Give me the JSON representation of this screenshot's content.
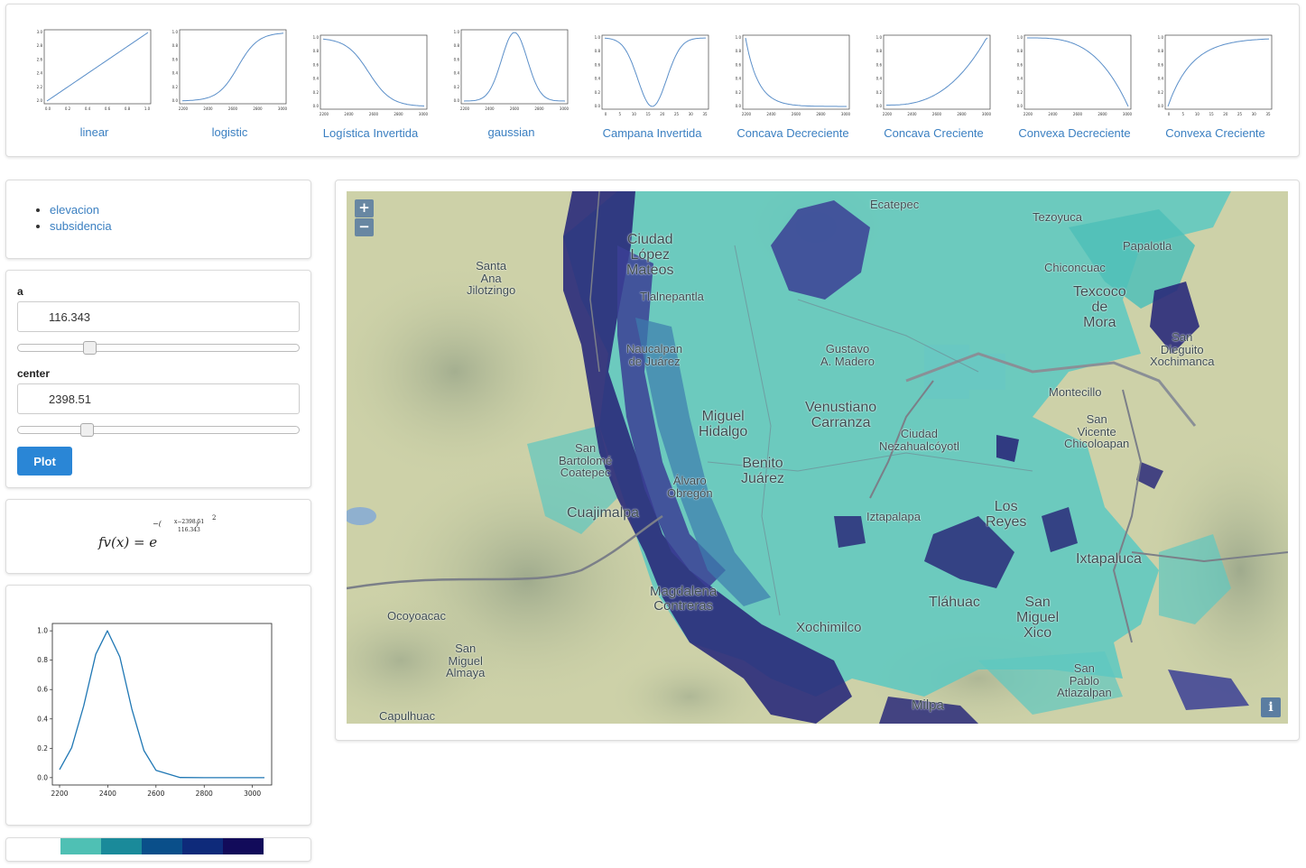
{
  "gallery": {
    "items": [
      {
        "label": "linear",
        "xticks": [
          "0.0",
          "0.2",
          "0.4",
          "0.6",
          "0.8",
          "1.0"
        ],
        "yticks": [
          "3.0",
          "2.8",
          "2.6",
          "2.4",
          "2.2",
          "2.0"
        ]
      },
      {
        "label": "logistic",
        "xticks": [
          "2200",
          "2400",
          "2600",
          "2800",
          "3000"
        ],
        "yticks": [
          "1.0",
          "0.8",
          "0.6",
          "0.4",
          "0.2",
          "0.0"
        ]
      },
      {
        "label": "Logística Invertida",
        "xticks": [
          "2200",
          "2400",
          "2600",
          "2800",
          "3000"
        ],
        "yticks": [
          "1.0",
          "0.8",
          "0.6",
          "0.4",
          "0.2",
          "0.0"
        ]
      },
      {
        "label": "gaussian",
        "xticks": [
          "2200",
          "2400",
          "2600",
          "2800",
          "3000"
        ],
        "yticks": [
          "1.0",
          "0.8",
          "0.6",
          "0.4",
          "0.2",
          "0.0"
        ]
      },
      {
        "label": "Campana Invertida",
        "xticks": [
          "0",
          "5",
          "10",
          "15",
          "20",
          "25",
          "30",
          "35"
        ],
        "yticks": [
          "1.0",
          "0.8",
          "0.6",
          "0.4",
          "0.2",
          "0.0"
        ]
      },
      {
        "label": "Concava Decreciente",
        "xticks": [
          "2200",
          "2400",
          "2600",
          "2800",
          "3000"
        ],
        "yticks": [
          "1.0",
          "0.8",
          "0.6",
          "0.4",
          "0.2",
          "0.0"
        ]
      },
      {
        "label": "Concava Creciente",
        "xticks": [
          "2200",
          "2400",
          "2600",
          "2800",
          "3000"
        ],
        "yticks": [
          "1.0",
          "0.8",
          "0.6",
          "0.4",
          "0.2",
          "0.0"
        ]
      },
      {
        "label": "Convexa Decreciente",
        "xticks": [
          "2200",
          "2400",
          "2600",
          "2800",
          "3000"
        ],
        "yticks": [
          "1.0",
          "0.8",
          "0.6",
          "0.4",
          "0.2",
          "0.0"
        ]
      },
      {
        "label": "Convexa Creciente",
        "xticks": [
          "0",
          "5",
          "10",
          "15",
          "20",
          "25",
          "30",
          "35"
        ],
        "yticks": [
          "1.0",
          "0.8",
          "0.6",
          "0.4",
          "0.2",
          "0.0"
        ]
      }
    ]
  },
  "layers": {
    "items": [
      {
        "label": "elevacion"
      },
      {
        "label": "subsidencia"
      }
    ]
  },
  "params": {
    "a": {
      "label": "a",
      "value": "116.343",
      "slider_fraction": 0.24
    },
    "center": {
      "label": "center",
      "value": "2398.51",
      "slider_fraction": 0.23
    },
    "plot_label": "Plot"
  },
  "formula": {
    "lhs": "fv(x) = e",
    "exp_num": "x−2398.51",
    "exp_den": "116.343",
    "power": "2"
  },
  "chart_data": {
    "type": "line",
    "title": "",
    "xlabel": "",
    "ylabel": "",
    "function": "gaussian",
    "center": 2398.51,
    "a": 116.343,
    "xlim": [
      2170,
      3080
    ],
    "ylim": [
      -0.05,
      1.05
    ],
    "xticks": [
      2200,
      2400,
      2600,
      2800,
      3000
    ],
    "yticks": [
      0.0,
      0.2,
      0.4,
      0.6,
      0.8,
      1.0
    ],
    "x": [
      2200,
      2250,
      2300,
      2350,
      2398.51,
      2450,
      2500,
      2550,
      2600,
      2700,
      2800,
      2900,
      3000,
      3050
    ],
    "y": [
      0.055,
      0.204,
      0.488,
      0.84,
      1.0,
      0.822,
      0.467,
      0.184,
      0.05,
      0.001,
      0.0,
      0.0,
      0.0,
      0.0
    ],
    "line_color": "#1f77b4"
  },
  "colorbar": {
    "colors": [
      "#4fc0b4",
      "#1a8a9a",
      "#0a4f8a",
      "#0e2a7a",
      "#120b5a"
    ]
  },
  "map": {
    "zoom_in": "+",
    "zoom_out": "−",
    "info": "i",
    "places": [
      {
        "name": "Ecatepec"
      },
      {
        "name": "Tezoyuca"
      },
      {
        "name": "Papalotla"
      },
      {
        "name": "Ciudad\nLópez\nMateos"
      },
      {
        "name": "Santa\nAna\nJilotzingo"
      },
      {
        "name": "Tlalnepantla"
      },
      {
        "name": "Chiconcuac"
      },
      {
        "name": "Texcoco\nde\nMora"
      },
      {
        "name": "San\nDieguito\nXochimanca"
      },
      {
        "name": "Naucalpan\nde Juárez"
      },
      {
        "name": "Gustavo\nA. Madero"
      },
      {
        "name": "Venustiano\nCarranza"
      },
      {
        "name": "Montecillo"
      },
      {
        "name": "Miguel\nHidalgo"
      },
      {
        "name": "Ciudad\nNezahualcóyotl"
      },
      {
        "name": "San\nVicente\nChicoloapan"
      },
      {
        "name": "San\nBartolomé\nCoatepec"
      },
      {
        "name": "Benito\nJuárez"
      },
      {
        "name": "Álvaro\nObregón"
      },
      {
        "name": "Cuajimalpa"
      },
      {
        "name": "Iztapalapa"
      },
      {
        "name": "Los\nReyes"
      },
      {
        "name": "Ixtapaluca"
      },
      {
        "name": "Magdalena\nContreras"
      },
      {
        "name": "Ocoyoacac"
      },
      {
        "name": "Tláhuac"
      },
      {
        "name": "Xochimilco"
      },
      {
        "name": "San\nMiguel\nXico"
      },
      {
        "name": "San\nMiguel\nAlmaya"
      },
      {
        "name": "San\nPablo\nAtlazalpan"
      },
      {
        "name": "Capulhuac"
      },
      {
        "name": "Milpa"
      }
    ]
  }
}
